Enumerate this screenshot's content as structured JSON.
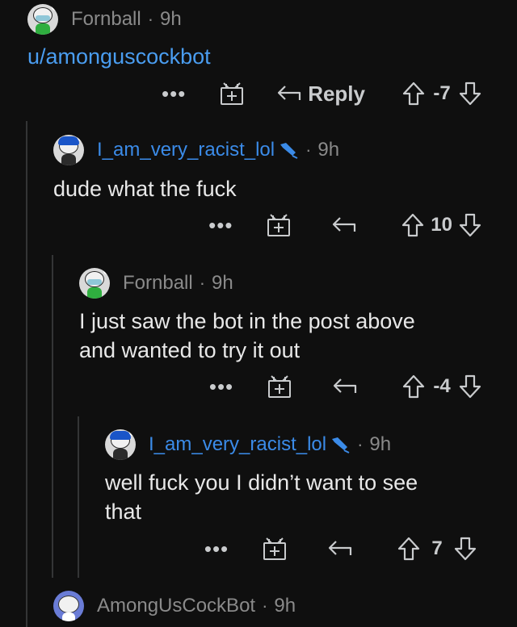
{
  "comments": [
    {
      "username": "Fornball",
      "separator": "·",
      "time": "9h",
      "body": "u/amonguscockbot",
      "reply_label": "Reply",
      "score": "-7",
      "avatar_icon": "snoo-avatar-masked-icon"
    },
    {
      "username": "I_am_very_racist_lol",
      "separator": "·",
      "time": "9h",
      "body": "dude what the fuck",
      "score": "10",
      "avatar_icon": "snoo-avatar-blue-hair-icon",
      "flair_icon": "dropper-flair-icon"
    },
    {
      "username": "Fornball",
      "separator": "·",
      "time": "9h",
      "body_line1": "I just saw the bot in the post above",
      "body_line2": "and wanted to try it out",
      "score": "-4",
      "avatar_icon": "snoo-avatar-masked-icon"
    },
    {
      "username": "I_am_very_racist_lol",
      "separator": "·",
      "time": "9h",
      "body_line1": "well fuck you I didn’t want to see",
      "body_line2": "that",
      "score": "7",
      "avatar_icon": "snoo-avatar-blue-hair-icon",
      "flair_icon": "dropper-flair-icon"
    },
    {
      "username": "AmongUsCockBot",
      "separator": "·",
      "time": "9h",
      "avatar_icon": "snoo-avatar-default-icon"
    }
  ],
  "colors": {
    "background": "#0f0f0f",
    "link_blue": "#3b8be8",
    "meta_gray": "#8a8a8a",
    "thread_line": "#343536"
  }
}
